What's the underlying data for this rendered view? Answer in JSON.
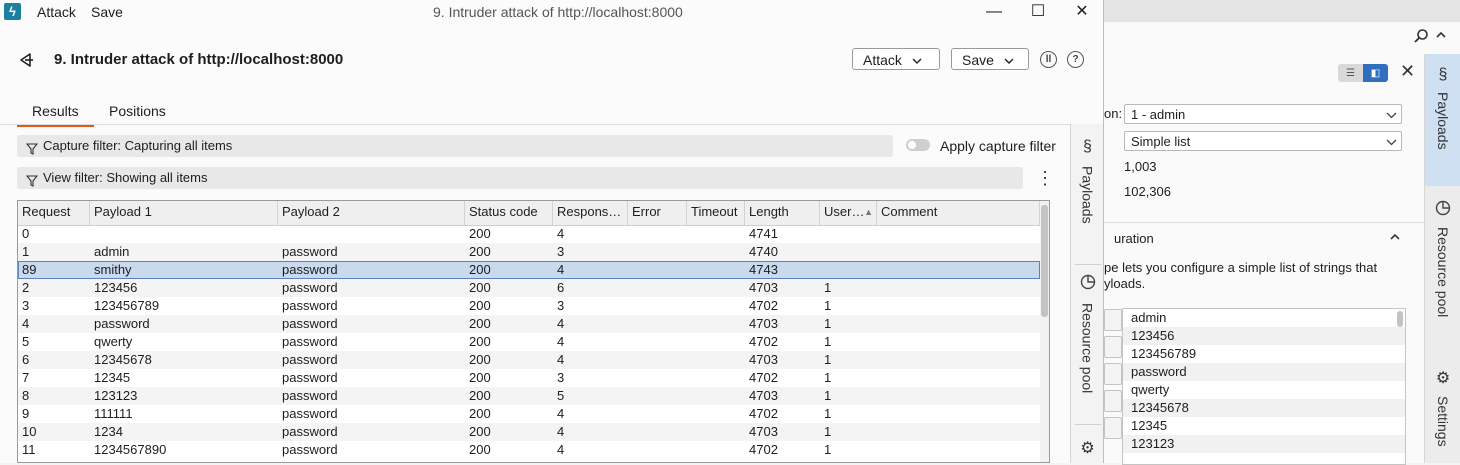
{
  "window": {
    "menu": [
      "Attack",
      "Save"
    ],
    "title": "9. Intruder attack of http://localhost:8000",
    "controls": {
      "minimize": "—",
      "maximize": "☐",
      "close": "✕"
    }
  },
  "header": {
    "title": "9. Intruder attack of http://localhost:8000",
    "attack_button": "Attack",
    "save_button": "Save"
  },
  "tabs": [
    "Results",
    "Positions"
  ],
  "filters": {
    "capture": "Capture filter: Capturing all items",
    "apply_capture": "Apply capture filter",
    "view": "View filter: Showing all items"
  },
  "table": {
    "columns": [
      "Request",
      "Payload 1",
      "Payload 2",
      "Status code",
      "Respons…",
      "Error",
      "Timeout",
      "Length",
      "User…",
      "Comment"
    ],
    "rows": [
      [
        "0",
        "",
        "",
        "200",
        "4",
        "",
        "",
        "4741",
        "",
        ""
      ],
      [
        "1",
        "admin",
        "password",
        "200",
        "3",
        "",
        "",
        "4740",
        "",
        ""
      ],
      [
        "89",
        "smithy",
        "password",
        "200",
        "4",
        "",
        "",
        "4743",
        "",
        ""
      ],
      [
        "2",
        "123456",
        "password",
        "200",
        "6",
        "",
        "",
        "4703",
        "1",
        ""
      ],
      [
        "3",
        "123456789",
        "password",
        "200",
        "3",
        "",
        "",
        "4702",
        "1",
        ""
      ],
      [
        "4",
        "password",
        "password",
        "200",
        "4",
        "",
        "",
        "4703",
        "1",
        ""
      ],
      [
        "5",
        "qwerty",
        "password",
        "200",
        "4",
        "",
        "",
        "4702",
        "1",
        ""
      ],
      [
        "6",
        "12345678",
        "password",
        "200",
        "4",
        "",
        "",
        "4703",
        "1",
        ""
      ],
      [
        "7",
        "12345",
        "password",
        "200",
        "3",
        "",
        "",
        "4702",
        "1",
        ""
      ],
      [
        "8",
        "123123",
        "password",
        "200",
        "5",
        "",
        "",
        "4703",
        "1",
        ""
      ],
      [
        "9",
        "111111",
        "password",
        "200",
        "4",
        "",
        "",
        "4702",
        "1",
        ""
      ],
      [
        "10",
        "1234",
        "password",
        "200",
        "4",
        "",
        "",
        "4703",
        "1",
        ""
      ],
      [
        "11",
        "1234567890",
        "password",
        "200",
        "4",
        "",
        "",
        "4702",
        "1",
        ""
      ]
    ],
    "selected_row": 2
  },
  "side_rail": [
    "Payloads",
    "Resource pool"
  ],
  "background": {
    "payload_position_label": "on:",
    "payload_position": "1 - admin",
    "payload_type": "Simple list",
    "count": "1,003",
    "request_count": "102,306",
    "section_title": "uration",
    "description": "pe lets you configure a simple list of strings that\nyloads.",
    "payload_list": [
      "admin",
      "123456",
      "123456789",
      "password",
      "qwerty",
      "12345678",
      "12345",
      "123123"
    ],
    "rail": [
      "Payloads",
      "Resource pool",
      "Settings"
    ]
  },
  "colors": {
    "accent_tab": "#e8541c",
    "selected_row": "#c9d9ee",
    "active_rail": "#cfe0f3"
  }
}
